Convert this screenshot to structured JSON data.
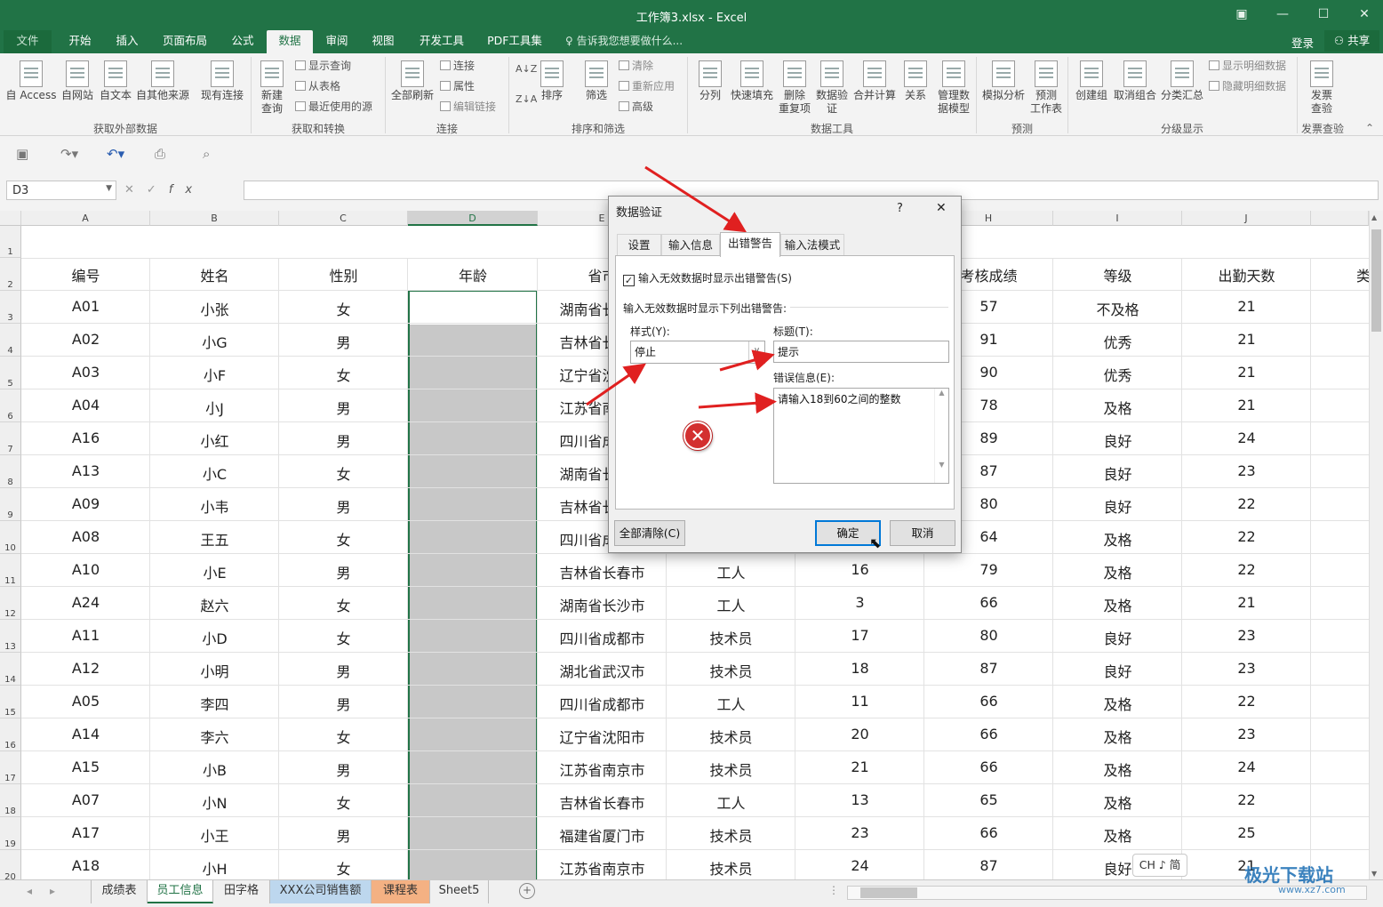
{
  "window": {
    "title": "工作簿3.xlsx - Excel",
    "controls": [
      "▣",
      "—",
      "☐",
      "✕"
    ]
  },
  "menu": {
    "tabs": [
      "文件",
      "开始",
      "插入",
      "页面布局",
      "公式",
      "数据",
      "审阅",
      "视图",
      "开发工具",
      "PDF工具集"
    ],
    "active": "数据",
    "tell_me": "告诉我您想要做什么...",
    "login": "登录",
    "share": "共享"
  },
  "ribbon": {
    "get_external": {
      "buttons": [
        "自 Access",
        "自网站",
        "自文本",
        "自其他来源",
        "现有连接"
      ],
      "label": "获取外部数据"
    },
    "get_transform": {
      "new_query": "新建\n查询",
      "items": [
        "显示查询",
        "从表格",
        "最近使用的源"
      ],
      "label": "获取和转换"
    },
    "connections": {
      "refresh": "全部刷新",
      "items": [
        "连接",
        "属性",
        "编辑链接"
      ],
      "label": "连接"
    },
    "sort_filter": {
      "sort": "排序",
      "filter": "筛选",
      "items": [
        "清除",
        "重新应用",
        "高级"
      ],
      "label": "排序和筛选"
    },
    "data_tools": {
      "buttons": [
        "分列",
        "快速填充",
        "删除\n重复项",
        "数据验\n证",
        "合并计算",
        "关系",
        "管理数\n据模型"
      ],
      "label": "数据工具"
    },
    "forecast": {
      "buttons": [
        "模拟分析",
        "预测\n工作表"
      ],
      "label": "预测"
    },
    "outline": {
      "buttons": [
        "创建组",
        "取消组合",
        "分类汇总"
      ],
      "items": [
        "显示明细数据",
        "隐藏明细数据"
      ],
      "label": "分级显示"
    },
    "invoice": {
      "button": "发票\n查验",
      "label": "发票查验"
    }
  },
  "name_box": "D3",
  "formula_value": "",
  "sheet": {
    "columns": [
      "A",
      "B",
      "C",
      "D",
      "E",
      "F",
      "G",
      "H",
      "I",
      "J"
    ],
    "selected_column": "D",
    "header_row": [
      "编号",
      "姓名",
      "性别",
      "年龄",
      "省市",
      "",
      "",
      "考核成绩",
      "等级",
      "出勤天数"
    ],
    "rows": [
      {
        "n": "3",
        "a": "A01",
        "b": "小张",
        "c": "女",
        "e": "湖南省长沙市",
        "f": "",
        "g": "",
        "h": "57",
        "i": "不及格",
        "j": "21"
      },
      {
        "n": "4",
        "a": "A02",
        "b": "小G",
        "c": "男",
        "e": "吉林省长春市",
        "f": "",
        "g": "",
        "h": "91",
        "i": "优秀",
        "j": "21"
      },
      {
        "n": "5",
        "a": "A03",
        "b": "小F",
        "c": "女",
        "e": "辽宁省沈阳市",
        "f": "",
        "g": "",
        "h": "90",
        "i": "优秀",
        "j": "21"
      },
      {
        "n": "6",
        "a": "A04",
        "b": "小J",
        "c": "男",
        "e": "江苏省南京市",
        "f": "",
        "g": "",
        "h": "78",
        "i": "及格",
        "j": "21"
      },
      {
        "n": "7",
        "a": "A16",
        "b": "小红",
        "c": "男",
        "e": "四川省成都市",
        "f": "",
        "g": "",
        "h": "89",
        "i": "良好",
        "j": "24"
      },
      {
        "n": "8",
        "a": "A13",
        "b": "小C",
        "c": "女",
        "e": "湖南省长沙市",
        "f": "",
        "g": "",
        "h": "87",
        "i": "良好",
        "j": "23"
      },
      {
        "n": "9",
        "a": "A09",
        "b": "小韦",
        "c": "男",
        "e": "吉林省长春市",
        "f": "",
        "g": "",
        "h": "80",
        "i": "良好",
        "j": "22"
      },
      {
        "n": "10",
        "a": "A08",
        "b": "王五",
        "c": "女",
        "e": "四川省成都市",
        "f": "",
        "g": "",
        "h": "64",
        "i": "及格",
        "j": "22"
      },
      {
        "n": "11",
        "a": "A10",
        "b": "小E",
        "c": "男",
        "e": "吉林省长春市",
        "f": "工人",
        "g": "16",
        "h": "79",
        "i": "及格",
        "j": "22"
      },
      {
        "n": "12",
        "a": "A24",
        "b": "赵六",
        "c": "女",
        "e": "湖南省长沙市",
        "f": "工人",
        "g": "3",
        "h": "66",
        "i": "及格",
        "j": "21"
      },
      {
        "n": "13",
        "a": "A11",
        "b": "小D",
        "c": "女",
        "e": "四川省成都市",
        "f": "技术员",
        "g": "17",
        "h": "80",
        "i": "良好",
        "j": "23"
      },
      {
        "n": "14",
        "a": "A12",
        "b": "小明",
        "c": "男",
        "e": "湖北省武汉市",
        "f": "技术员",
        "g": "18",
        "h": "87",
        "i": "良好",
        "j": "23"
      },
      {
        "n": "15",
        "a": "A05",
        "b": "李四",
        "c": "男",
        "e": "四川省成都市",
        "f": "工人",
        "g": "11",
        "h": "66",
        "i": "及格",
        "j": "22"
      },
      {
        "n": "16",
        "a": "A14",
        "b": "李六",
        "c": "女",
        "e": "辽宁省沈阳市",
        "f": "技术员",
        "g": "20",
        "h": "66",
        "i": "及格",
        "j": "23"
      },
      {
        "n": "17",
        "a": "A15",
        "b": "小B",
        "c": "男",
        "e": "江苏省南京市",
        "f": "技术员",
        "g": "21",
        "h": "66",
        "i": "及格",
        "j": "24"
      },
      {
        "n": "18",
        "a": "A07",
        "b": "小N",
        "c": "女",
        "e": "吉林省长春市",
        "f": "工人",
        "g": "13",
        "h": "65",
        "i": "及格",
        "j": "22"
      },
      {
        "n": "19",
        "a": "A17",
        "b": "小王",
        "c": "男",
        "e": "福建省厦门市",
        "f": "技术员",
        "g": "23",
        "h": "66",
        "i": "及格",
        "j": "25"
      },
      {
        "n": "20",
        "a": "A18",
        "b": "小H",
        "c": "女",
        "e": "江苏省南京市",
        "f": "技术员",
        "g": "24",
        "h": "87",
        "i": "良好",
        "j": "21"
      }
    ]
  },
  "sheet_tabs": {
    "tabs": [
      "成绩表",
      "员工信息",
      "田字格",
      "XXX公司销售额",
      "课程表",
      "Sheet5"
    ],
    "active": "员工信息",
    "colors": {
      "XXX公司销售额": "#bdd7ee",
      "课程表": "#f4b183"
    }
  },
  "dialog": {
    "title": "数据验证",
    "help": "?",
    "close": "✕",
    "tabs": [
      "设置",
      "输入信息",
      "出错警告",
      "输入法模式"
    ],
    "active_tab": "出错警告",
    "checkbox_label": "输入无效数据时显示出错警告(S)",
    "checkbox_checked": true,
    "section_label": "输入无效数据时显示下列出错警告:",
    "style_label": "样式(Y):",
    "style_value": "停止",
    "title_label": "标题(T):",
    "title_value": "提示",
    "message_label": "错误信息(E):",
    "message_value": "请输入18到60之间的整数",
    "clear_all": "全部清除(C)",
    "ok": "确定",
    "cancel": "取消"
  },
  "ime": "CH ♪ 简",
  "watermark": {
    "logo": "极光下载站",
    "url": "www.xz7.com"
  }
}
